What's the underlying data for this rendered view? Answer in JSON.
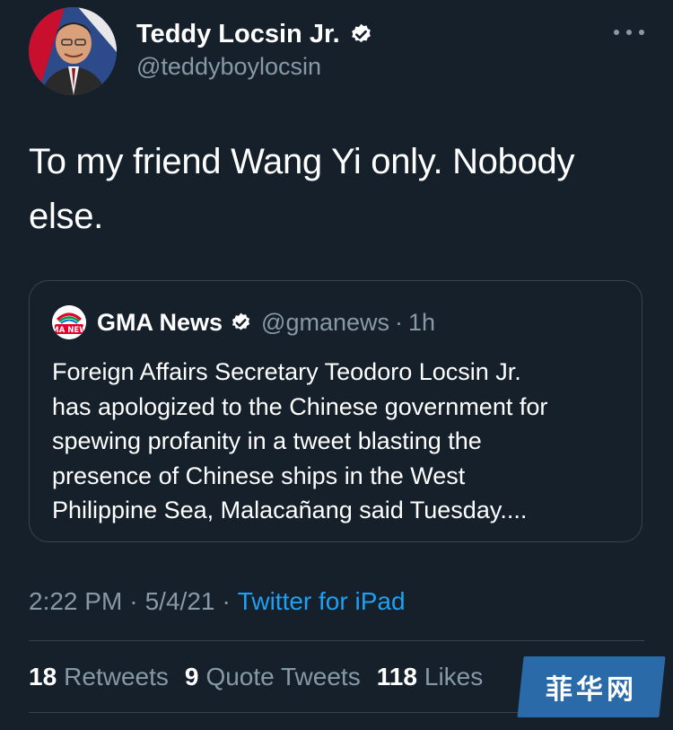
{
  "author": {
    "name": "Teddy Locsin Jr.",
    "handle": "@teddyboylocsin",
    "verified": true
  },
  "tweet": {
    "text_line1": "To my friend Wang Yi only. Nobody",
    "text_line2": "else."
  },
  "quote": {
    "logo_text": "GMA NEWS",
    "name": "GMA News",
    "handle": "@gmanews",
    "dot": "·",
    "time": "1h",
    "text_lines": [
      "Foreign Affairs Secretary Teodoro Locsin Jr.",
      "has apologized to the Chinese government for",
      "spewing profanity in a tweet blasting the",
      "presence of Chinese ships in the West",
      "Philippine Sea, Malacañang said Tuesday...."
    ]
  },
  "meta": {
    "time": "2:22 PM",
    "sep1": "·",
    "date": "5/4/21",
    "sep2": "·",
    "source": "Twitter for iPad"
  },
  "stats": {
    "retweets_count": "18",
    "retweets_label": "Retweets",
    "quotes_count": "9",
    "quotes_label": "Quote Tweets",
    "likes_count": "118",
    "likes_label": "Likes"
  },
  "watermark": {
    "text": "菲华网"
  },
  "colors": {
    "background": "#15202b",
    "text_primary": "#ffffff",
    "text_secondary": "#8899a6",
    "link": "#1da1f2",
    "border": "#38444d"
  },
  "icons": {
    "verified": "verified-badge-icon",
    "more": "more-options-icon"
  }
}
